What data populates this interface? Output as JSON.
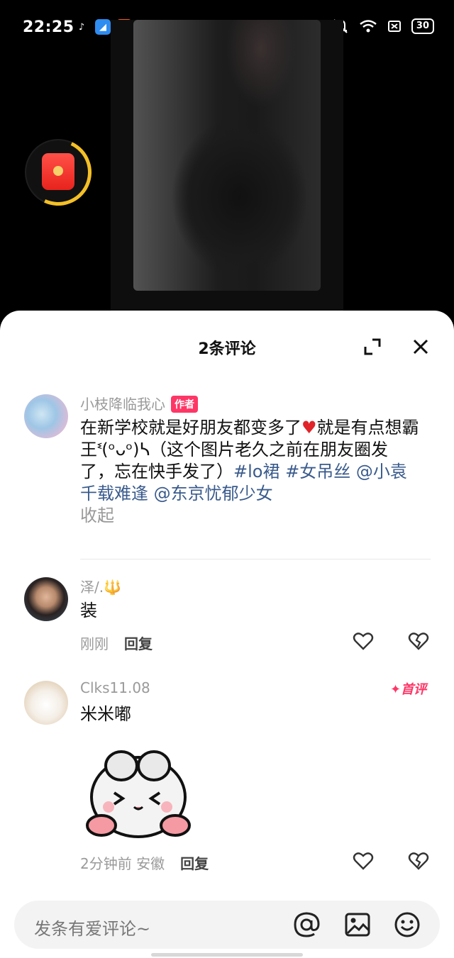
{
  "status_bar": {
    "time": "22:25",
    "battery": "30",
    "app_icons": [
      {
        "name": "tiktok-icon",
        "glyph": "♪",
        "bg": "#000000",
        "fg": "#ffffff"
      },
      {
        "name": "blue-app-icon",
        "glyph": "◢",
        "bg": "#2f8cf0",
        "fg": "#ffffff"
      },
      {
        "name": "kuaishou-icon",
        "glyph": "▶",
        "bg": "#ff5b1a",
        "fg": "#ffffff"
      }
    ]
  },
  "colors": {
    "accent_pink": "#fe3666",
    "link_blue": "#3a5b8c",
    "red_packet": "#e8231d",
    "ring_yellow": "#f5c026"
  },
  "sheet": {
    "title": "2条评论"
  },
  "post": {
    "username": "小枝降临我心",
    "author_tag": "作者",
    "text_before_heart": "在新学校就是好朋友都变多了",
    "heart": "❤️",
    "text_after_heart": "就是有点想霸王ᓫ(ᵒᴗᵒ)ᓴ（这个图片老久之前在朋友圈发了，忘在快手发了）",
    "hashtags": [
      "#lo裙",
      "#女吊丝"
    ],
    "mentions": [
      "@小袁千载难逢",
      "@东京忧郁少女"
    ],
    "collapse_label": "收起"
  },
  "comments": [
    {
      "username": "泽/.🔱",
      "text": "装",
      "time": "刚刚",
      "location": "",
      "reply_label": "回复",
      "badge": ""
    },
    {
      "username": "Clks11.08",
      "text": "米米嘟",
      "time": "2分钟前",
      "location": "安徽",
      "reply_label": "回复",
      "badge": "首评"
    }
  ],
  "input_bar": {
    "placeholder": "发条有爱评论~",
    "icons": [
      "at-icon",
      "image-icon",
      "emoji-icon"
    ]
  }
}
